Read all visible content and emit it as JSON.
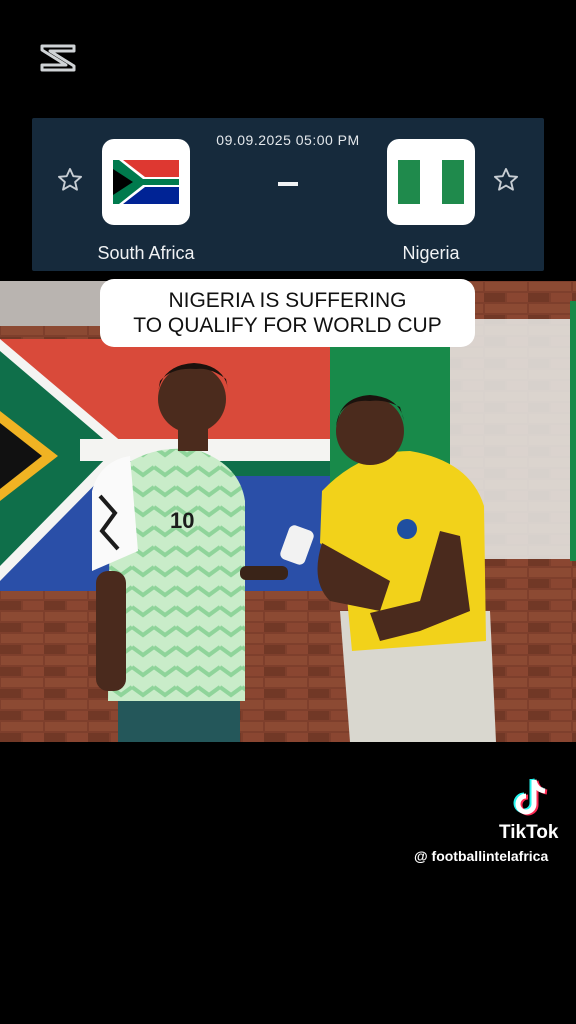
{
  "match": {
    "datetime": "09.09.2025 05:00 PM",
    "separator": "-",
    "home_team": "South Africa",
    "away_team": "Nigeria"
  },
  "caption": {
    "line1": "NIGERIA IS SUFFERING",
    "line2": "TO QUALIFY FOR WORLD CUP"
  },
  "jersey_number": "10",
  "watermark": {
    "app": "TikTok",
    "handle": "@ footballintelafrica"
  },
  "colors": {
    "card_bg": "#162a3c",
    "nigeria_green": "#1f8a4c",
    "sa_green": "#007a4d",
    "sa_red": "#de3831",
    "sa_blue": "#002395",
    "sa_gold": "#ffb612"
  },
  "icons": [
    "capcut-icon",
    "star-icon",
    "tiktok-icon"
  ]
}
